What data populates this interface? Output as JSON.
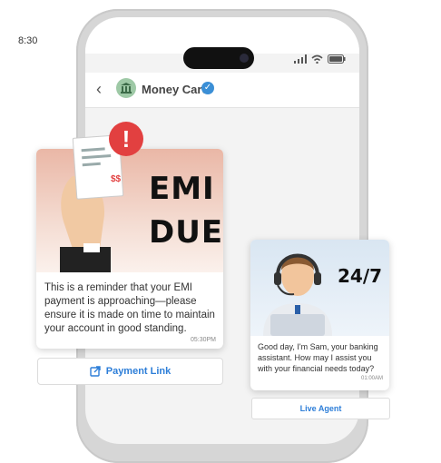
{
  "status_bar": {
    "time": "8:30"
  },
  "chat_header": {
    "business_name": "Money Care",
    "verified_icon": "check-badge-icon",
    "back_icon": "chevron-left-icon"
  },
  "emi_card": {
    "headline_line1": "EMI",
    "headline_line2": "DUE",
    "currency_mark": "$$",
    "alert_glyph": "!",
    "message": "This is a reminder that your EMI payment is approaching—please ensure it is made on time to maintain your account in good standing.",
    "timestamp": "05:30PM"
  },
  "payment_button": {
    "label": "Payment Link",
    "icon": "external-link-icon"
  },
  "agent_card": {
    "badge": "24/7",
    "message": "Good day, I'm Sam, your banking assistant. How may I assist you with your financial needs today?",
    "timestamp": "01:00AM"
  },
  "agent_button": {
    "label": "Live Agent"
  },
  "colors": {
    "accent": "#2d7ed8",
    "alert": "#e24040",
    "verified": "#3b8fd6"
  }
}
